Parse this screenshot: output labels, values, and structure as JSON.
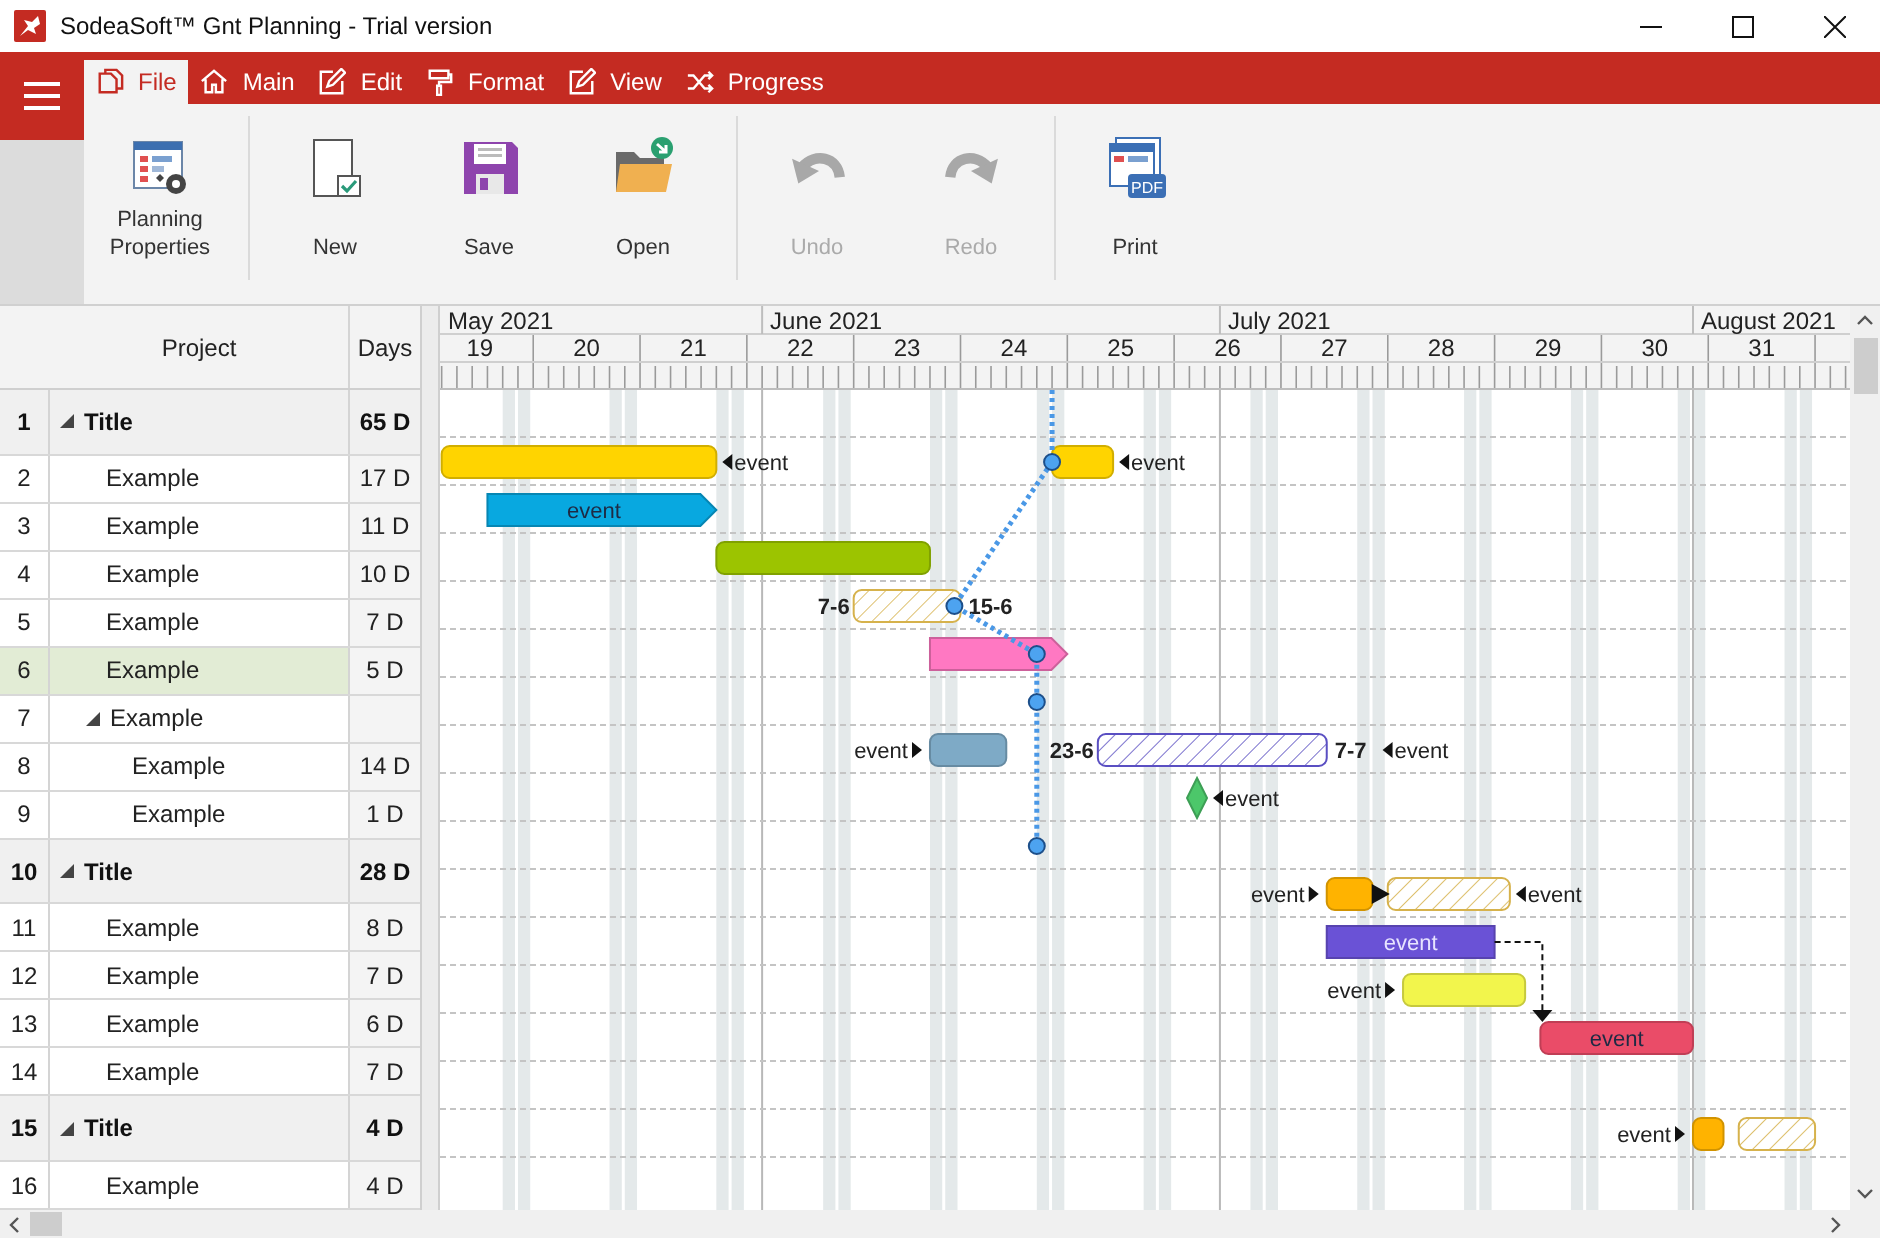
{
  "window": {
    "title": "SodeaSoft™ Gnt Planning - Trial version"
  },
  "menu_tabs": [
    {
      "label": "File",
      "kind": "file",
      "selected": true
    },
    {
      "label": "Main",
      "kind": "home",
      "selected": false
    },
    {
      "label": "Edit",
      "kind": "edit",
      "selected": false
    },
    {
      "label": "Format",
      "kind": "format",
      "selected": false
    },
    {
      "label": "View",
      "kind": "view",
      "selected": false
    },
    {
      "label": "Progress",
      "kind": "progress",
      "selected": false
    }
  ],
  "toolbar": [
    {
      "label": "Planning Properties",
      "kind": "properties",
      "disabled": false
    },
    {
      "label": "New",
      "kind": "new",
      "disabled": false
    },
    {
      "label": "Save",
      "kind": "save",
      "disabled": false
    },
    {
      "label": "Open",
      "kind": "open",
      "disabled": false
    },
    {
      "label": "Undo",
      "kind": "undo",
      "disabled": true
    },
    {
      "label": "Redo",
      "kind": "redo",
      "disabled": true
    },
    {
      "label": "Print",
      "kind": "print",
      "disabled": false,
      "badge": "PDF"
    }
  ],
  "grid": {
    "columns": [
      "Project",
      "Days"
    ],
    "rows": [
      {
        "number": "1",
        "name": "Title",
        "days": "65 D",
        "kind": "title",
        "expanded": true,
        "selected": false,
        "children": [
          {
            "number": "2",
            "name": "Example",
            "days": "17 D",
            "kind": "item",
            "selected": false,
            "marks": [
              {
                "kind": "bar",
                "color": "#ffd400",
                "right_note": "event"
              },
              {
                "kind": "bar",
                "color": "#ffd400",
                "right_note": "event"
              },
              {
                "kind": "pin"
              }
            ]
          },
          {
            "number": "3",
            "name": "Example",
            "days": "11 D",
            "kind": "item",
            "selected": false,
            "marks": [
              {
                "kind": "arrow",
                "color": "#08a8e0",
                "label": "event"
              }
            ]
          },
          {
            "number": "4",
            "name": "Example",
            "days": "10 D",
            "kind": "item",
            "selected": false,
            "marks": [
              {
                "kind": "bar",
                "color": "#9cc400"
              }
            ]
          },
          {
            "number": "5",
            "name": "Example",
            "days": "7 D",
            "kind": "item",
            "selected": false,
            "marks": [
              {
                "kind": "hatched",
                "color": "#d6b24c",
                "left_date": "7-6",
                "right_date": "15-6"
              },
              {
                "kind": "pin"
              }
            ]
          },
          {
            "number": "6",
            "name": "Example",
            "days": "5 D",
            "kind": "item",
            "selected": true,
            "marks": [
              {
                "kind": "arrow",
                "color": "#ff78c2"
              },
              {
                "kind": "pin"
              }
            ]
          },
          {
            "number": "7",
            "name": "Example",
            "kind": "item",
            "expanded": true,
            "selected": false,
            "marks": [
              {
                "kind": "pin"
              }
            ],
            "children": [
              {
                "number": "8",
                "name": "Example",
                "days": "14 D",
                "kind": "item",
                "selected": false,
                "marks": [
                  {
                    "kind": "bar",
                    "color": "#7eaac6",
                    "left_note": "event"
                  },
                  {
                    "kind": "hatched",
                    "color": "#5a4fc2",
                    "left_date": "23-6",
                    "right_date": "7-7",
                    "right_note": "event"
                  }
                ]
              },
              {
                "number": "9",
                "name": "Example",
                "days": "1 D",
                "kind": "item",
                "selected": false,
                "marks": [
                  {
                    "kind": "diamond",
                    "color": "#4cc76a",
                    "right_note": "event"
                  }
                ]
              }
            ]
          }
        ]
      },
      {
        "number": "10",
        "name": "Title",
        "days": "28 D",
        "kind": "title",
        "expanded": true,
        "selected": false,
        "marks": [
          {
            "kind": "pin"
          }
        ],
        "children": [
          {
            "number": "11",
            "name": "Example",
            "days": "8 D",
            "kind": "item",
            "selected": false,
            "marks": [
              {
                "kind": "bar",
                "color": "#ffb300",
                "left_note": "event",
                "link_right": true
              },
              {
                "kind": "hatched",
                "color": "#d6b24c",
                "right_note": "event"
              }
            ]
          },
          {
            "number": "12",
            "name": "Example",
            "days": "7 D",
            "kind": "item",
            "selected": false,
            "marks": [
              {
                "kind": "block",
                "color": "#6a52d6",
                "label": "event",
                "link_down": true
              }
            ]
          },
          {
            "number": "13",
            "name": "Example",
            "days": "6 D",
            "kind": "item",
            "selected": false,
            "marks": [
              {
                "kind": "bar",
                "color": "#f2f54c",
                "left_note": "event"
              }
            ]
          },
          {
            "number": "14",
            "name": "Example",
            "days": "7 D",
            "kind": "item",
            "selected": false,
            "marks": [
              {
                "kind": "bar",
                "color": "#ea4c68",
                "label": "event"
              }
            ]
          }
        ]
      },
      {
        "number": "15",
        "name": "Title",
        "days": "4 D",
        "kind": "title",
        "expanded": true,
        "selected": false,
        "children": [
          {
            "number": "16",
            "name": "Example",
            "days": "4 D",
            "kind": "item",
            "selected": false,
            "marks": [
              {
                "kind": "bar",
                "color": "#ffb300",
                "left_note": "event"
              },
              {
                "kind": "hatched",
                "color": "#d6b24c"
              }
            ]
          }
        ]
      }
    ]
  },
  "gantt": {
    "months": [
      "May 2021",
      "June 2021",
      "July 2021",
      "August 2021"
    ],
    "weeks": [
      "19",
      "20",
      "21",
      "22",
      "23",
      "24",
      "25",
      "26",
      "27",
      "28",
      "29",
      "30",
      "31"
    ]
  }
}
